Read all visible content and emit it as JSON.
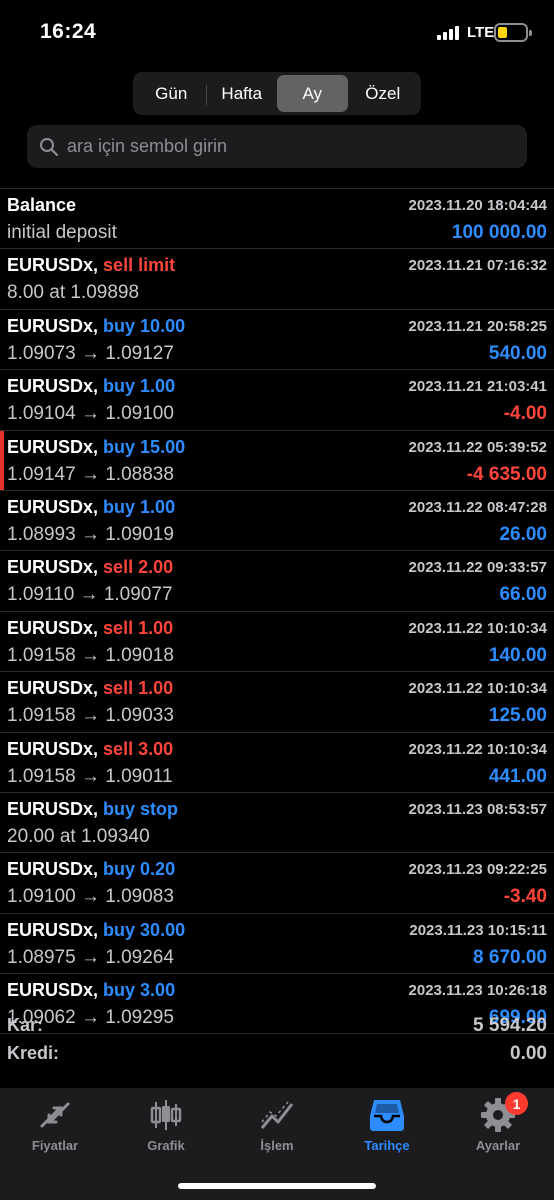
{
  "status": {
    "time": "16:24",
    "network": "LTE"
  },
  "periods": [
    {
      "label": "Gün",
      "active": false
    },
    {
      "label": "Hafta",
      "active": false
    },
    {
      "label": "Ay",
      "active": true
    },
    {
      "label": "Özel",
      "active": false
    }
  ],
  "search": {
    "placeholder": "ara için sembol girin"
  },
  "deals": [
    {
      "symbol": "Balance",
      "side": "",
      "side_type": "neutral",
      "date": "2023.11.20 18:04:44",
      "detail": "initial deposit",
      "amount": "100 000.00",
      "amount_type": "pos",
      "marked": false
    },
    {
      "symbol": "EURUSDx,",
      "side": "sell limit",
      "side_type": "sell",
      "date": "2023.11.21 07:16:32",
      "detail": "8.00 at 1.09898",
      "amount": "",
      "amount_type": "pos",
      "marked": false
    },
    {
      "symbol": "EURUSDx,",
      "side": "buy 10.00",
      "side_type": "buy",
      "date": "2023.11.21 20:58:25",
      "detail": "1.09073 → 1.09127",
      "amount": "540.00",
      "amount_type": "pos",
      "marked": false
    },
    {
      "symbol": "EURUSDx,",
      "side": "buy 1.00",
      "side_type": "buy",
      "date": "2023.11.21 21:03:41",
      "detail": "1.09104 → 1.09100",
      "amount": "-4.00",
      "amount_type": "neg",
      "marked": false
    },
    {
      "symbol": "EURUSDx,",
      "side": "buy 15.00",
      "side_type": "buy",
      "date": "2023.11.22 05:39:52",
      "detail": "1.09147 → 1.08838",
      "amount": "-4 635.00",
      "amount_type": "neg",
      "marked": true
    },
    {
      "symbol": "EURUSDx,",
      "side": "buy 1.00",
      "side_type": "buy",
      "date": "2023.11.22 08:47:28",
      "detail": "1.08993 → 1.09019",
      "amount": "26.00",
      "amount_type": "pos",
      "marked": false
    },
    {
      "symbol": "EURUSDx,",
      "side": "sell 2.00",
      "side_type": "sell",
      "date": "2023.11.22 09:33:57",
      "detail": "1.09110 → 1.09077",
      "amount": "66.00",
      "amount_type": "pos",
      "marked": false
    },
    {
      "symbol": "EURUSDx,",
      "side": "sell 1.00",
      "side_type": "sell",
      "date": "2023.11.22 10:10:34",
      "detail": "1.09158 → 1.09018",
      "amount": "140.00",
      "amount_type": "pos",
      "marked": false
    },
    {
      "symbol": "EURUSDx,",
      "side": "sell 1.00",
      "side_type": "sell",
      "date": "2023.11.22 10:10:34",
      "detail": "1.09158 → 1.09033",
      "amount": "125.00",
      "amount_type": "pos",
      "marked": false
    },
    {
      "symbol": "EURUSDx,",
      "side": "sell 3.00",
      "side_type": "sell",
      "date": "2023.11.22 10:10:34",
      "detail": "1.09158 → 1.09011",
      "amount": "441.00",
      "amount_type": "pos",
      "marked": false
    },
    {
      "symbol": "EURUSDx,",
      "side": "buy stop",
      "side_type": "buy",
      "date": "2023.11.23 08:53:57",
      "detail": "20.00 at 1.09340",
      "amount": "",
      "amount_type": "pos",
      "marked": false
    },
    {
      "symbol": "EURUSDx,",
      "side": "buy 0.20",
      "side_type": "buy",
      "date": "2023.11.23 09:22:25",
      "detail": "1.09100 → 1.09083",
      "amount": "-3.40",
      "amount_type": "neg",
      "marked": false
    },
    {
      "symbol": "EURUSDx,",
      "side": "buy 30.00",
      "side_type": "buy",
      "date": "2023.11.23 10:15:11",
      "detail": "1.08975 → 1.09264",
      "amount": "8 670.00",
      "amount_type": "pos",
      "marked": false
    },
    {
      "symbol": "EURUSDx,",
      "side": "buy 3.00",
      "side_type": "buy",
      "date": "2023.11.23 10:26:18",
      "detail": "1.09062 → 1.09295",
      "amount": "699.00",
      "amount_type": "pos",
      "marked": false
    }
  ],
  "summary": [
    {
      "label": "Kar:",
      "value": "5 594.20"
    },
    {
      "label": "Kredi:",
      "value": "0.00"
    }
  ],
  "tabs": [
    {
      "label": "Fiyatlar",
      "icon": "quotes-arrows-icon",
      "active": false
    },
    {
      "label": "Grafik",
      "icon": "candlestick-chart-icon",
      "active": false
    },
    {
      "label": "İşlem",
      "icon": "trade-line-chart-icon",
      "active": false
    },
    {
      "label": "Tarihçe",
      "icon": "history-inbox-icon",
      "active": true
    },
    {
      "label": "Ayarlar",
      "icon": "gear-icon",
      "active": false,
      "badge": "1"
    }
  ],
  "colors": {
    "buy": "#2d8cff",
    "sell": "#ff453a",
    "accent": "#2d8cff",
    "marker": "#e5332e"
  }
}
